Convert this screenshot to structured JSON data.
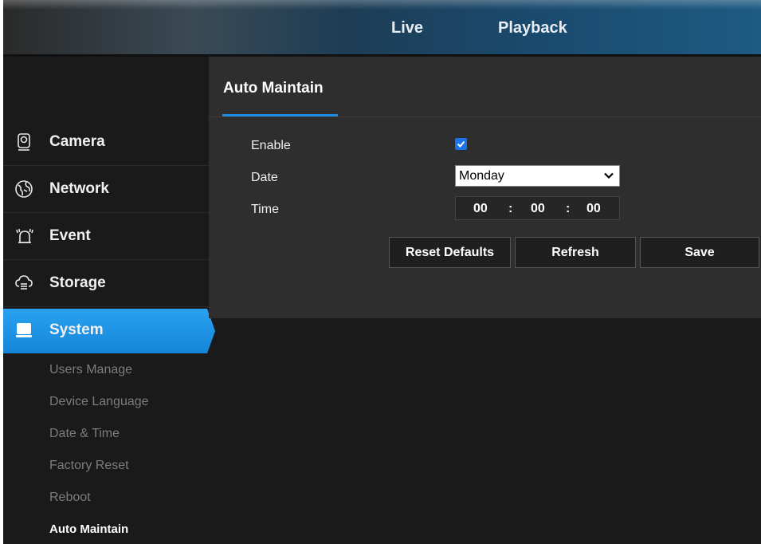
{
  "header": {
    "tabs": [
      {
        "label": "Live"
      },
      {
        "label": "Playback"
      }
    ]
  },
  "sidebar": {
    "items": [
      {
        "label": "Camera",
        "icon": "camera-icon"
      },
      {
        "label": "Network",
        "icon": "globe-icon"
      },
      {
        "label": "Event",
        "icon": "alarm-bell-icon"
      },
      {
        "label": "Storage",
        "icon": "cloud-storage-icon"
      },
      {
        "label": "System",
        "icon": "monitor-icon",
        "active": true
      }
    ],
    "sub_items": [
      {
        "label": "Users Manage"
      },
      {
        "label": "Device Language"
      },
      {
        "label": "Date & Time"
      },
      {
        "label": "Factory Reset"
      },
      {
        "label": "Reboot"
      },
      {
        "label": "Auto Maintain",
        "active": true
      }
    ]
  },
  "main": {
    "title": "Auto Maintain",
    "form": {
      "enable_label": "Enable",
      "enable_checked": true,
      "date_label": "Date",
      "date_value": "Monday",
      "time_label": "Time",
      "time_hour": "00",
      "time_minute": "00",
      "time_second": "00",
      "time_separator": ":"
    },
    "buttons": {
      "reset": "Reset Defaults",
      "refresh": "Refresh",
      "save": "Save"
    }
  },
  "colors": {
    "accent": "#1e8ce0",
    "active_item": "#1a8fe3",
    "panel": "#2e2e2e",
    "background": "#1a1a1a"
  }
}
